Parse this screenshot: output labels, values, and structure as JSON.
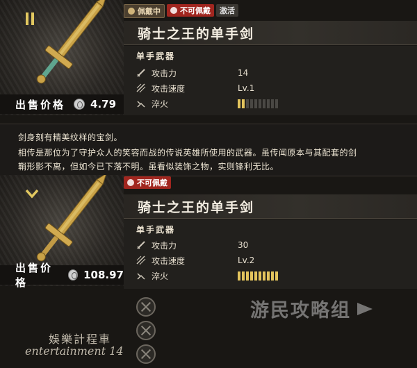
{
  "item1": {
    "badges": {
      "equipped": "佩戴中",
      "not_equippable": "不可佩戴",
      "activate": "激活"
    },
    "title": "骑士之王的单手剑",
    "weapon_type": "单手武器",
    "stats": {
      "attack_label": "攻击力",
      "attack_value": "14",
      "speed_label": "攻击速度",
      "speed_value": "Lv.1",
      "temper_label": "淬火",
      "temper_level": 2,
      "temper_max": 10
    },
    "price_label": "出售价格",
    "price_value": "4.79"
  },
  "description": {
    "line1": "剑身刻有精美纹样的宝剑。",
    "line2": "相传是那位为了守护众人的笑容而战的传说英雄所使用的武器。虽传闻原本与其配套的剑",
    "line3": "鞘形影不离，但如今已下落不明。虽看似装饰之物，实则锋利无比。"
  },
  "item2": {
    "badges": {
      "not_equippable": "不可佩戴"
    },
    "title": "骑士之王的单手剑",
    "weapon_type": "单手武器",
    "stats": {
      "attack_label": "攻击力",
      "attack_value": "30",
      "speed_label": "攻击速度",
      "speed_value": "Lv.2",
      "temper_label": "淬火",
      "temper_level": 10,
      "temper_max": 10
    },
    "price_label": "出售价格",
    "price_value": "108.97"
  },
  "watermarks": {
    "site": "游民攻略组",
    "cn": "娛樂計程車",
    "en": "entertainment 14"
  },
  "colors": {
    "accent_gold": "#e3c45d",
    "badge_red": "#a1261f",
    "panel_dark": "#22201d"
  }
}
